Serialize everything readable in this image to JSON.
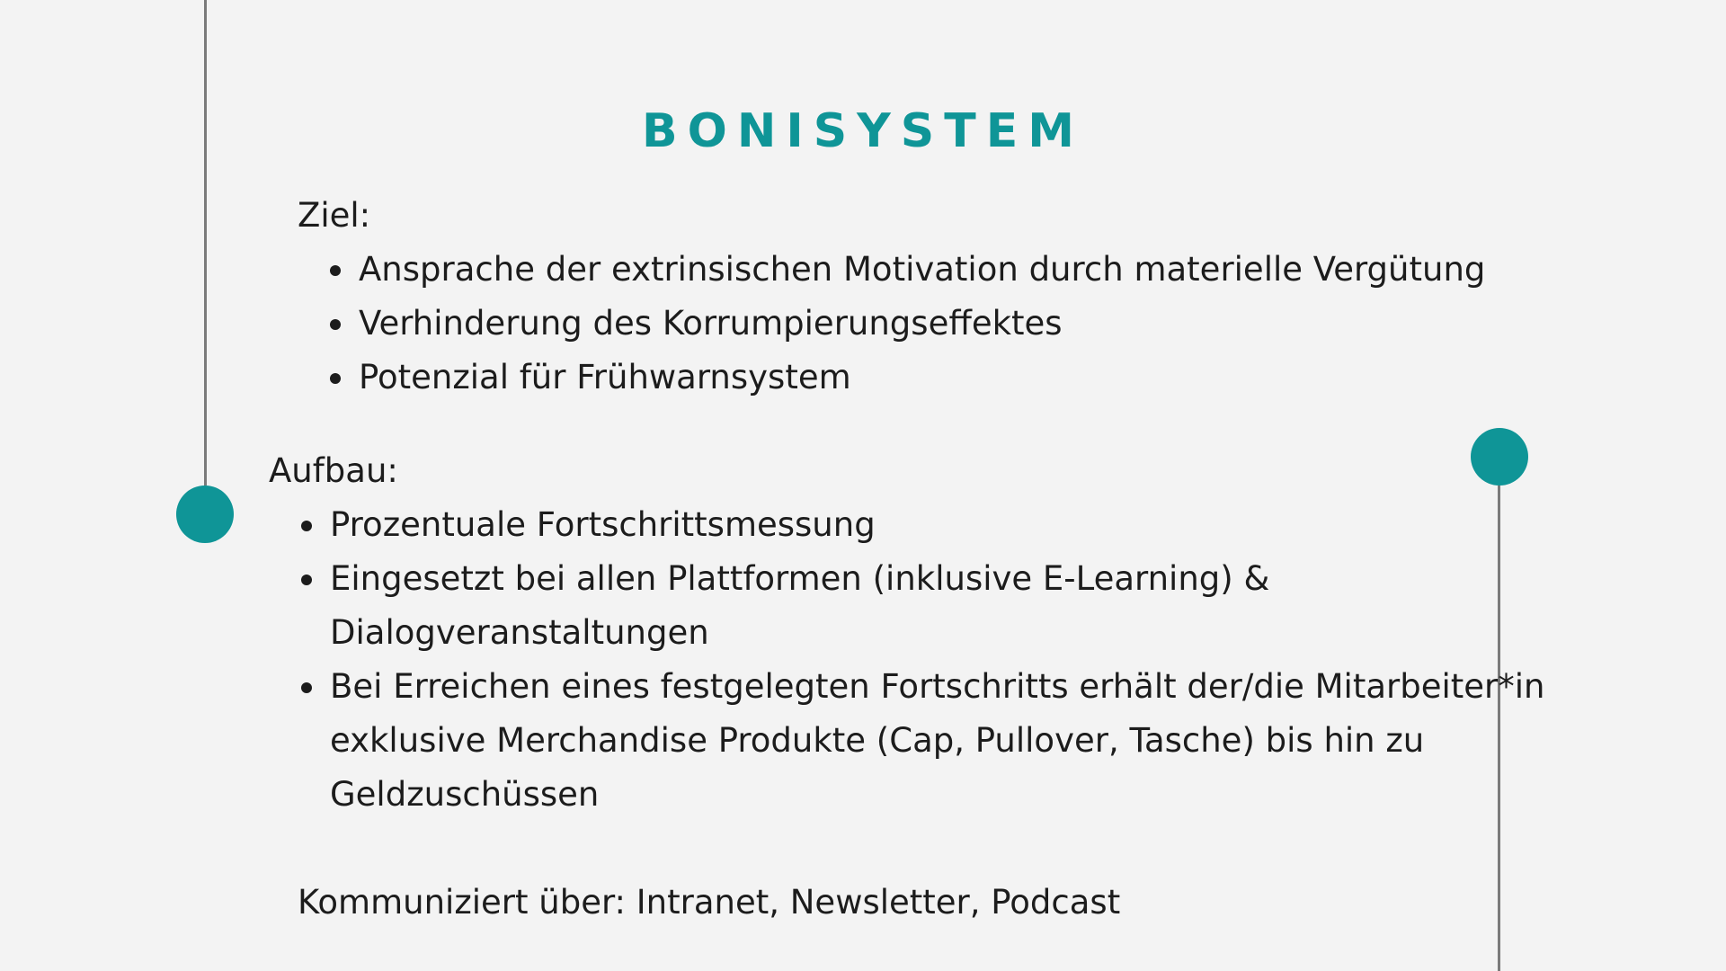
{
  "title": "BONISYSTEM",
  "ziel": {
    "label": "Ziel:",
    "items": [
      "Ansprache der extrinsischen Motivation durch materielle Vergütung",
      "Verhinderung des Korrumpierungseffektes",
      "Potenzial für Frühwarnsystem"
    ]
  },
  "aufbau": {
    "label": "Aufbau:",
    "items": [
      {
        "lines": [
          "Prozentuale Fortschrittsmessung"
        ]
      },
      {
        "lines": [
          "Eingesetzt bei allen Plattformen (inklusive E-Learning) &",
          "Dialogveranstaltungen"
        ]
      },
      {
        "lines": [
          "Bei Erreichen eines festgelegten Fortschritts erhält der/die Mitarbeiter*in",
          "exklusive Merchandise Produkte (Cap, Pullover, Tasche) bis hin zu",
          "Geldzuschüssen"
        ]
      }
    ]
  },
  "kommuniziert": "Kommuniziert über: Intranet, Newsletter, Podcast",
  "colors": {
    "accent": "#0f9597",
    "text": "#1c1c1c",
    "line": "#7a7a7a",
    "background": "#f3f3f3"
  }
}
